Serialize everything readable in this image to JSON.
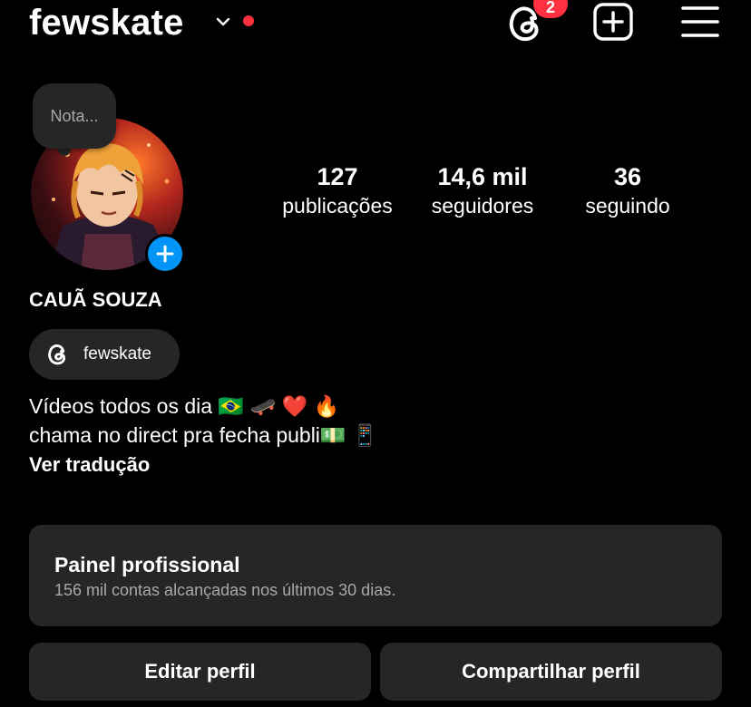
{
  "header": {
    "username": "fewskate",
    "threads_badge": "2"
  },
  "profile": {
    "note_placeholder": "Nota...",
    "full_name": "CAUÃ SOUZA",
    "threads_handle": "fewskate",
    "bio_lines": [
      "Vídeos todos os dia 🇧🇷 🛹 ❤️ 🔥",
      "chama no direct pra fecha publi💵 📱"
    ],
    "translate_label": "Ver tradução"
  },
  "stats": [
    {
      "value": "127",
      "label": "publicações"
    },
    {
      "value": "14,6 mil",
      "label": "seguidores"
    },
    {
      "value": "36",
      "label": "seguindo"
    }
  ],
  "dashboard": {
    "title": "Painel profissional",
    "subtitle": "156 mil contas alcançadas nos últimos 30 dias."
  },
  "actions": {
    "edit_label": "Editar perfil",
    "share_label": "Compartilhar perfil"
  },
  "colors": {
    "background": "#000000",
    "surface": "#262626",
    "accent_blue": "#0095f6",
    "notification_red": "#ff3040",
    "secondary_text": "#a8a8a8"
  },
  "icons": {
    "chevron": "chevron-down-icon",
    "threads": "threads-icon",
    "add": "add-post-icon",
    "menu": "hamburger-menu-icon"
  }
}
